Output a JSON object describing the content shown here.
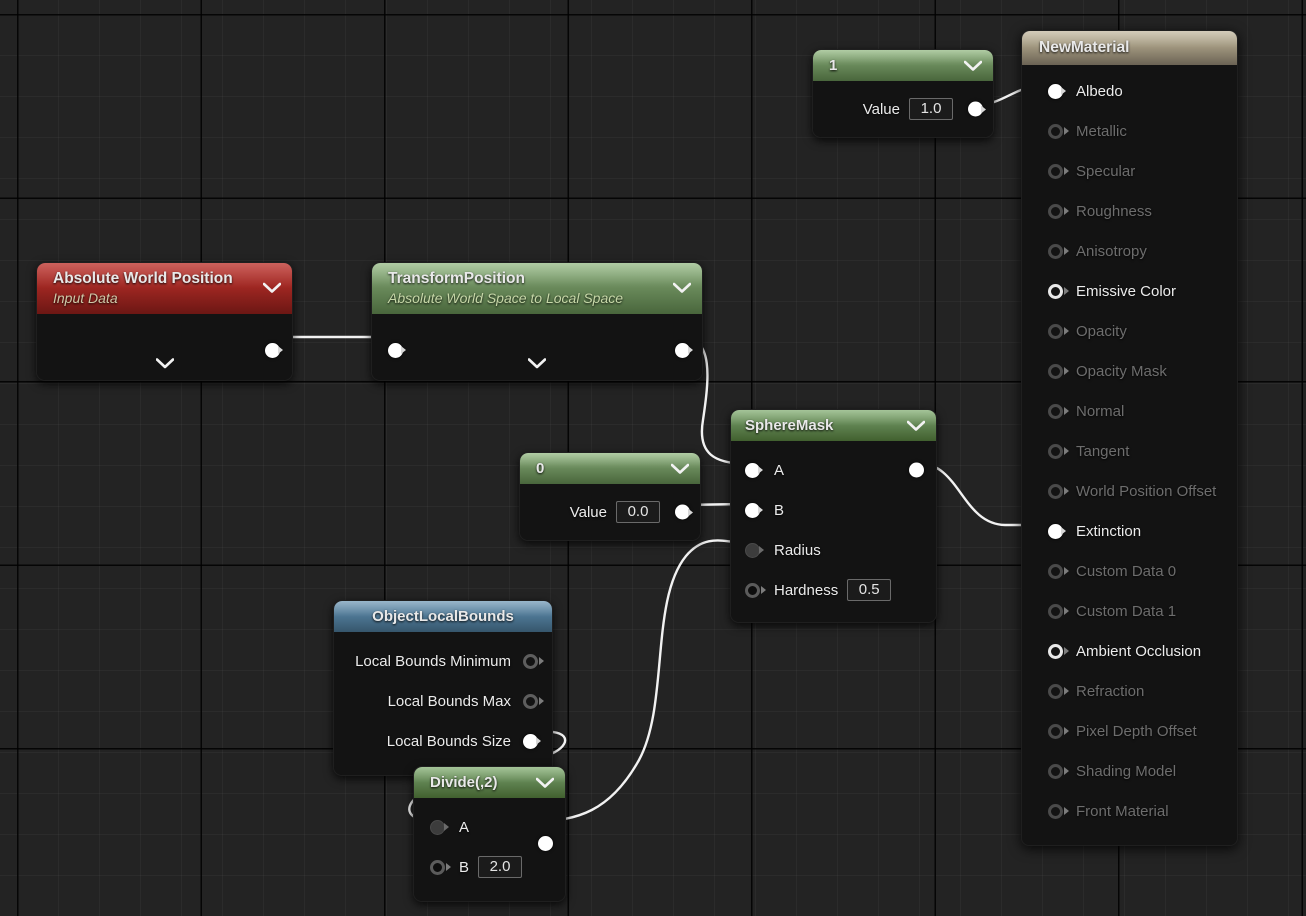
{
  "app": {
    "name": "material-node-graph"
  },
  "material_output": {
    "title": "NewMaterial",
    "inputs": [
      {
        "label": "Albedo",
        "connected": true
      },
      {
        "label": "Metallic",
        "connected": false
      },
      {
        "label": "Specular",
        "connected": false
      },
      {
        "label": "Roughness",
        "connected": false
      },
      {
        "label": "Anisotropy",
        "connected": false
      },
      {
        "label": "Emissive Color",
        "connected": false,
        "highlight": true
      },
      {
        "label": "Opacity",
        "connected": false
      },
      {
        "label": "Opacity Mask",
        "connected": false
      },
      {
        "label": "Normal",
        "connected": false
      },
      {
        "label": "Tangent",
        "connected": false
      },
      {
        "label": "World Position Offset",
        "connected": false
      },
      {
        "label": "Extinction",
        "connected": true
      },
      {
        "label": "Custom Data 0",
        "connected": false
      },
      {
        "label": "Custom Data 1",
        "connected": false
      },
      {
        "label": "Ambient Occlusion",
        "connected": false,
        "highlight": true
      },
      {
        "label": "Refraction",
        "connected": false
      },
      {
        "label": "Pixel Depth Offset",
        "connected": false
      },
      {
        "label": "Shading Model",
        "connected": false
      },
      {
        "label": "Front Material",
        "connected": false
      }
    ]
  },
  "nodes": {
    "const_one": {
      "title": "1",
      "value_label": "Value",
      "value": "1.0"
    },
    "const_zero": {
      "title": "0",
      "value_label": "Value",
      "value": "0.0"
    },
    "absolute_world_position": {
      "title": "Absolute World Position",
      "subtitle": "Input Data"
    },
    "transform_position": {
      "title": "TransformPosition",
      "subtitle": "Absolute World Space to Local Space"
    },
    "sphere_mask": {
      "title": "SphereMask",
      "inputs": [
        {
          "label": "A",
          "state": "filled"
        },
        {
          "label": "B",
          "state": "filled"
        },
        {
          "label": "Radius",
          "state": "dim"
        },
        {
          "label": "Hardness",
          "state": "hollow-dark",
          "value": "0.5"
        }
      ]
    },
    "object_local_bounds": {
      "title": "ObjectLocalBounds",
      "outputs": [
        {
          "label": "Local Bounds Minimum",
          "state": "hollow"
        },
        {
          "label": "Local Bounds Max",
          "state": "hollow"
        },
        {
          "label": "Local Bounds Size",
          "state": "filled"
        }
      ]
    },
    "divide": {
      "title": "Divide(,2)",
      "inputs": [
        {
          "label": "A",
          "state": "dim"
        },
        {
          "label": "B",
          "state": "hollow-dark",
          "value": "2.0"
        }
      ]
    }
  },
  "icons": {
    "chevron_down": "chevron-down-icon"
  },
  "colors": {
    "background": "#232323",
    "node_body": "#131313",
    "header_green": "#6d8e5e",
    "header_red": "#a02722",
    "header_blue": "#4d7693",
    "header_tan": "#a1977f",
    "wire": "#f2f2f2",
    "pin_connected": "#ffffff",
    "label_dim": "#6d6d6d"
  }
}
